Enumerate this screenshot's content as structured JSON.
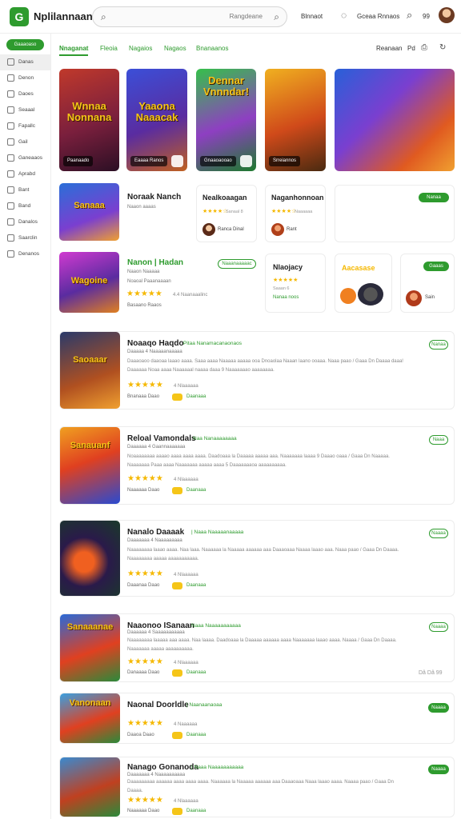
{
  "header": {
    "logo_letter": "G",
    "app_title": "Nplilannaan",
    "search_placeholder": "Rangdeane",
    "link1": "Blnnaot",
    "link2": "Gceaa Rnnaos",
    "count": "99"
  },
  "sidebar": {
    "button": "Gaaaoaso",
    "items": [
      "Danas",
      "Denon",
      "Daoes",
      "Seaaal",
      "Fapallc",
      "Gail",
      "Ganeaaos",
      "Aprabd",
      "Bant",
      "Band",
      "Danalos",
      "Saarclin",
      "Denanos"
    ]
  },
  "tabs": {
    "items": [
      "Nnaganat",
      "Fleoia",
      "Nagaios",
      "Nagaos",
      "Bnanaanos"
    ],
    "right1": "Reanaan",
    "right2": "Pd"
  },
  "featured": [
    {
      "art": "Wnnaa Nonnana",
      "badge": "Paanaado"
    },
    {
      "art": "Yaaona Naaacak",
      "badge": "Eaaaa Ranos"
    },
    {
      "art": "Dennar Vnnndar!",
      "badge": "Gnaaoaooao"
    },
    {
      "art": "",
      "badge": "Srreiannos"
    },
    {
      "art": "",
      "badge": ""
    }
  ],
  "row1": {
    "thumb_art": "Sanaaa",
    "title": "Noraak Nanch",
    "sub": "Naaon aaaas",
    "card2": {
      "title": "Nealkoaagan",
      "stars": "★★★★☆",
      "sub": "Sanaal 8",
      "player": "Ranca Dinal"
    },
    "card3": {
      "title": "Naganhonnoan",
      "stars": "★★★★☆",
      "sub": "Naaaaaa",
      "player": "Rant"
    },
    "card4": {
      "pill": "Nanaa"
    }
  },
  "row2": {
    "thumb_art": "Wagoine",
    "title": "Nanon | Hadan",
    "sub1": "Naaon Naaaaa",
    "sub2": "Noaoal Paaanaaaan",
    "stars": "★★★★★",
    "rating": "4.4 Naanaaalinc",
    "meta": "Basaano Raaos",
    "pill": "Naaanaaaaac",
    "card2": {
      "title": "Nlaojacy",
      "stars": "★★★★★",
      "sub": "Saaan 6",
      "chip": "Nanaa noos"
    },
    "card3": {
      "art": "Aacasase"
    },
    "card4": {
      "pill": "Gaaas",
      "player": "Sain"
    }
  },
  "list": [
    {
      "art": "Saoaaar",
      "title": "Noaaqo Haqdo",
      "tag": "Pitaa Nanamacanaonaos",
      "sub1": "Daaaaa 4 Naaaaanaaaaa",
      "desc": "Daaaoaoo daaoaa laaao aaaa. Saaa aaaa Naaaaa aaaaa ooa Dnoaolaa Naaan laano ooaaa. Naaa paao / Gaaa Dn Daaaa daaa! Daaaaaa Noaa aaaa Naaaaaal naaaa daaa 9 Naaaaaaao aaaaaaaa.",
      "stars": "★★★★★",
      "rating": "4 Nlaaaaaa",
      "meta": "Bnanaaa Daao",
      "meta_btn": "Daanaaa",
      "pill": "Nanaa",
      "side": ""
    },
    {
      "art": "Sanauanf",
      "title": "Reloal Vamondals",
      "tag": "Naa Nanaaaaaaaa",
      "sub1": "Daaaaaa 4 Gaannaaaaaaa",
      "desc": "Noaaaaaaaa aaaao aaaa aaaa aaaa. Daadoaaa la Daaaaa aaaaa aaa. Naaaaaaa laaaa 9 Daaao oaaa / Gaaa Dn Naaaaa. Naaaaaaa Paaa aaaa Naaaaaaa aaaaa aaaa 5 Daaaaaaaoa aaaaaaaaaa.",
      "stars": "★★★★★",
      "rating": "4 Nlaaaaaa",
      "meta": "Naaaaaa Daao",
      "meta_btn": "Daanaaa",
      "pill": "Naaa",
      "side": ""
    },
    {
      "art": "",
      "title": "Nanalo Daaaak",
      "tag": "| Naaa Naaaaanaaaaa",
      "sub1": "Daaaaaaa 4 Naaaaaaaaa",
      "desc": "Naaaaaaaa laaao aaaa. Naa laaa. Naaaaaa la Naaaaa aaaaaa aaa Daaaoaaa Naaaa laaao aaa. Naaa paao / Gaaa Dn Daaaa. Naaaaaaaa aaaaa aaaaaaaaaaa.",
      "stars": "★★★★★",
      "rating": "4 Nlaaaaaa",
      "meta": "Daaanaa Daao",
      "meta_btn": "Daanaaa",
      "pill": "Naaaa",
      "side": ""
    },
    {
      "art": "Sanaaanae",
      "title": "Naaonoo ISanaan",
      "tag": "Naaa Naaaaaaaaaaa",
      "sub1": "Daaaaaa 4 Saaaaaaaaaaa",
      "desc": "Naaaaaaaa laaaaa aaa aaaa. Naa laaaa. Daadoaaa la Daaaaa aaaaaa aaaa Naaaaaaa laaao aaaa. Naaaa / Gaaa Dn Daaaa. Naaaaaaa aaaaa aaaaaaaaaa.",
      "stars": "★★★★★",
      "rating": "4 Nlaaaaaa",
      "meta": "Danaaaa Daao",
      "meta_btn": "Daanaaa",
      "pill": "Naaaa",
      "side": "Dâ Dâ 99"
    },
    {
      "art": "Vanonaan",
      "title": "Naonal Doorldle",
      "tag": "| Naanaanaoaa",
      "sub1": "",
      "desc": "",
      "stars": "★★★★★",
      "rating": "4 Naaaaaa",
      "meta": "Daaoa Daao",
      "meta_btn": "Daanaaa",
      "pill": "Naaaa",
      "side": ""
    },
    {
      "art": "",
      "title": "Nanago Gonanoda",
      "tag": "| Naaa Naaaaaaaaaaa",
      "sub1": "Daaaaaaa 4 Naaaaaaaaaa",
      "desc": "Daaaaaaaaa aaaaaa aaaa aaaa aaaa. Naaaaaa la Naaaaa aaaaaa aaa Daaaoaaa Naaa laaao aaaa. Naaaa paao / Gaaa Dn Daaaa.",
      "stars": "★★★★★",
      "rating": "4 Nlaaaaaa",
      "meta": "Naaaaaa Daao",
      "meta_btn": "Daanaaa",
      "pill": "Naaaa",
      "side": ""
    }
  ],
  "colors": {
    "accent": "#2e9b2e",
    "star": "#f5b800",
    "gold": "#f5c518"
  }
}
